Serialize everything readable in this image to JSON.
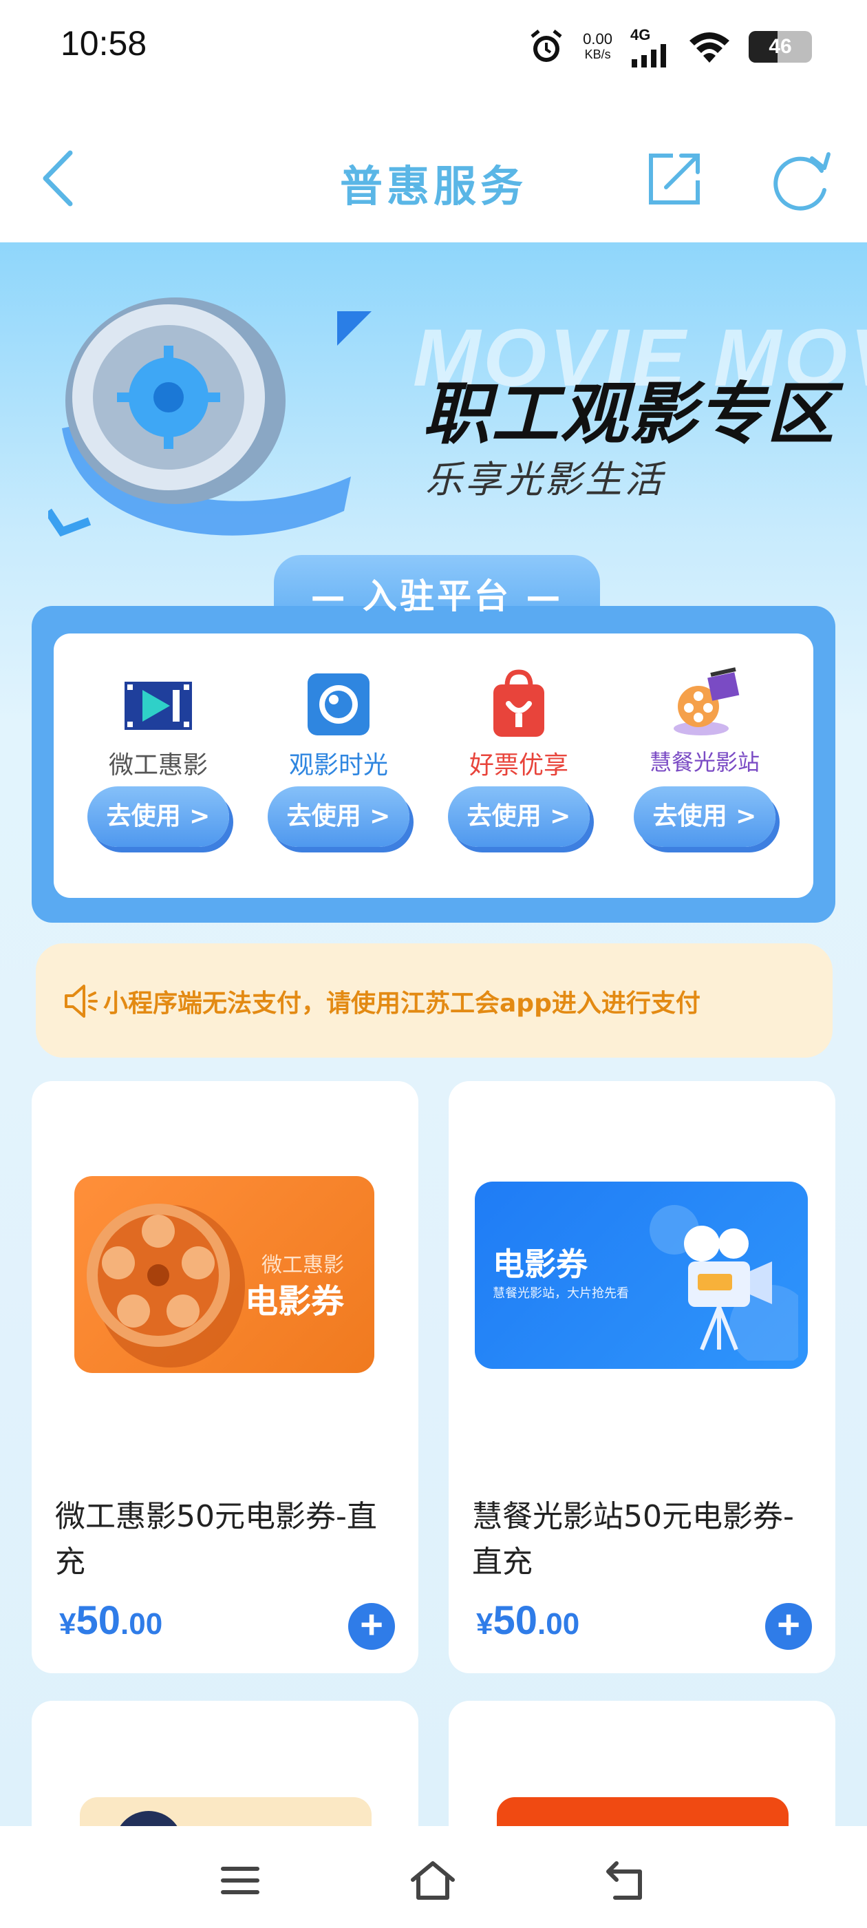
{
  "status_bar": {
    "time": "10:58",
    "net_speed_value": "0.00",
    "net_speed_unit": "KB/s",
    "network_type": "4G",
    "battery": "46"
  },
  "nav": {
    "title": "普惠服务"
  },
  "hero": {
    "watermark": "MOVIE MOVIE",
    "title": "职工观影专区",
    "subtitle": "乐享光影生活"
  },
  "platforms": {
    "section_title": "— 入驻平台 —",
    "items": [
      {
        "name": "微工惠影",
        "button": "去使用 >",
        "color": "#555555"
      },
      {
        "name": "观影时光",
        "button": "去使用 >",
        "color": "#2f86e0"
      },
      {
        "name": "好票优享",
        "button": "去使用 >",
        "color": "#e8443b"
      },
      {
        "name": "慧餐光影站",
        "button": "去使用 >",
        "color": "#7a4bc4"
      }
    ]
  },
  "notice": {
    "text": "小程序端无法支付，请使用江苏工会app进入进行支付"
  },
  "products": [
    {
      "banner_small": "微工惠影",
      "banner_big": "电影券",
      "title": "微工惠影50元电影券-直充",
      "currency": "¥",
      "price_int": "50",
      "price_dec": ".00"
    },
    {
      "banner_big": "电影券",
      "banner_small": "慧餐光影站，大片抢先看",
      "title": "慧餐光影站50元电影券-直充",
      "currency": "¥",
      "price_int": "50",
      "price_dec": ".00"
    }
  ],
  "colors": {
    "accent": "#2f7ce8",
    "nav_title": "#5ab6e6",
    "notice_text": "#e38a13",
    "notice_bg": "#fdf0d6"
  }
}
